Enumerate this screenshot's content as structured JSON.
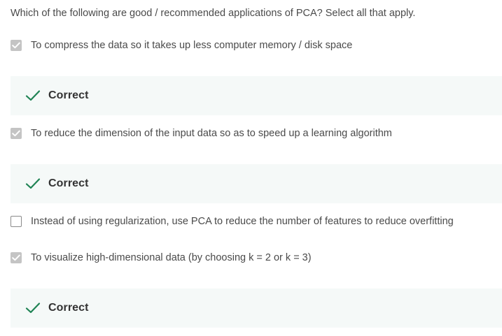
{
  "question": {
    "text": "Which of the following are good / recommended applications of PCA? Select all that apply."
  },
  "options": [
    {
      "label": "To compress the data so it takes up less computer memory / disk space",
      "checked": true,
      "feedback": "Correct"
    },
    {
      "label": "To reduce the dimension of the input data so as to speed up a learning algorithm",
      "checked": true,
      "feedback": "Correct"
    },
    {
      "label": "Instead of using regularization, use PCA to reduce the number of features to reduce overfitting",
      "checked": false,
      "feedback": null
    },
    {
      "label": "To visualize high-dimensional data (by choosing k = 2 or k = 3)",
      "checked": true,
      "feedback": "Correct"
    }
  ],
  "colors": {
    "correct_check": "#1f8354",
    "checkbox_checked": "#c4c4c4",
    "feedback_bg": "#f5f9f8"
  },
  "icons": {
    "checkbox_mark": "checkmark-icon",
    "feedback_mark": "correct-check-icon"
  }
}
